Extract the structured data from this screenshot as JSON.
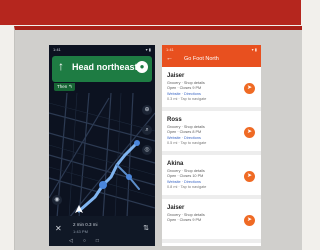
{
  "colors": {
    "banner_red": "#b5261e",
    "nav_green": "#1e7c43",
    "map_bg": "#0c1220",
    "route_blue": "#7fb4f0",
    "list_orange": "#e8501f",
    "fab_orange": "#ef6a24"
  },
  "phone1": {
    "status_left": "1:41",
    "status_right": "▾ ▮",
    "direction_icon": "arrow-up-icon",
    "direction": "Head northeast",
    "then_label": "Then ↰",
    "bottom_eta": "2 min  0.3 mi",
    "bottom_sub": "1:43 PM",
    "close_symbol": "✕",
    "route_symbol": "⇅",
    "nav_keys": "◁○□"
  },
  "phone2": {
    "status_left": "1:41",
    "status_right": "▾ ▮",
    "back_symbol": "←",
    "title": "Go Foot North",
    "items": [
      {
        "name": "Jaiser",
        "line1": "Grocery · Shop details",
        "line2": "Open · Closes 9 PM",
        "link": "Website · Directions",
        "meta": "0.3 mi · Tap to navigate"
      },
      {
        "name": "Ross",
        "line1": "Grocery · Shop details",
        "line2": "Open · Closes 8 PM",
        "link": "Website · Directions",
        "meta": "0.5 mi · Tap to navigate"
      },
      {
        "name": "Akina",
        "line1": "Grocery · Shop details",
        "line2": "Open · Closes 10 PM",
        "link": "Website · Directions",
        "meta": "0.8 mi · Tap to navigate"
      },
      {
        "name": "Jaiser",
        "line1": "Grocery · Shop details",
        "line2": "Open · Closes 9 PM",
        "link": "",
        "meta": ""
      }
    ]
  }
}
